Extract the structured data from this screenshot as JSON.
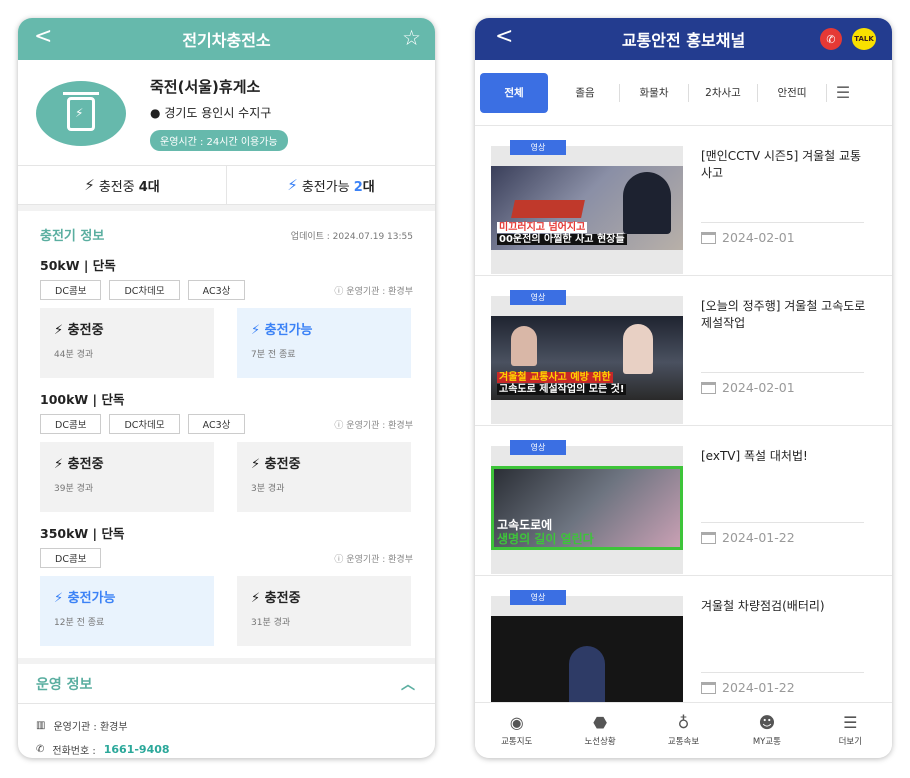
{
  "left": {
    "header": {
      "title": "전기차충전소",
      "back": "<",
      "star": "☆"
    },
    "station": {
      "name": "죽전(서울)휴게소",
      "address": "경기도 용인시 수지구",
      "hours": "운영시간 : 24시간 이용가능"
    },
    "status": {
      "charging_label": "충전중",
      "charging_count": "4대",
      "available_label": "충전가능",
      "available_count": "2",
      "available_unit": "대"
    },
    "charger_info": {
      "title": "충전기 정보",
      "updated": "업데이트 : 2024.07.19 13:55",
      "groups": [
        {
          "power": "50kW | 단독",
          "tags": [
            "DC콤보",
            "DC차데모",
            "AC3상"
          ],
          "operator": "ⓘ 운영기관 : 환경부",
          "slots": [
            {
              "status": "충전중",
              "sub": "44분 경과",
              "available": false
            },
            {
              "status": "충전가능",
              "sub": "7분 전 종료",
              "available": true
            }
          ]
        },
        {
          "power": "100kW | 단독",
          "tags": [
            "DC콤보",
            "DC차데모",
            "AC3상"
          ],
          "operator": "ⓘ 운영기관 : 환경부",
          "slots": [
            {
              "status": "충전중",
              "sub": "39분 경과",
              "available": false
            },
            {
              "status": "충전중",
              "sub": "3분 경과",
              "available": false
            }
          ]
        },
        {
          "power": "350kW | 단독",
          "tags": [
            "DC콤보"
          ],
          "operator": "ⓘ 운영기관 : 환경부",
          "slots": [
            {
              "status": "충전가능",
              "sub": "12분 전 종료",
              "available": true
            },
            {
              "status": "충전중",
              "sub": "31분 경과",
              "available": false
            }
          ]
        }
      ]
    },
    "operation": {
      "title": "운영 정보",
      "operator": "운영기관 : 환경부",
      "phone_label": "전화번호 :",
      "phone": "1661-9408"
    }
  },
  "right": {
    "header": {
      "title": "교통안전 홍보채널",
      "back": "<",
      "talk": "TALK"
    },
    "tabs": [
      "전체",
      "졸음",
      "화물차",
      "2차사고",
      "안전띠"
    ],
    "items": [
      {
        "badge": "영상",
        "title": "[맨인CCTV 시즌5] 겨울철 교통사고",
        "date": "2024-02-01",
        "caption1": "미끄러지고 넘어지고",
        "caption2": "00운전의 아찔한 사고 현장들"
      },
      {
        "badge": "영상",
        "title": "[오늘의 정주행] 겨울철 고속도로 제설작업",
        "date": "2024-02-01",
        "caption1": "겨울철 교통사고 예방 위한",
        "caption2": "고속도로 제설작업의 모든 것!"
      },
      {
        "badge": "영상",
        "title": "[exTV] 폭설 대처법!",
        "date": "2024-01-22",
        "caption1": "고속도로에",
        "caption2": "생명의 길이 열린다"
      },
      {
        "badge": "영상",
        "title": "겨울철 차량점검(배터리)",
        "date": "2024-01-22",
        "caption1": "",
        "caption2": ""
      }
    ],
    "nav": [
      "교통지도",
      "노선상황",
      "교통속보",
      "MY교통",
      "더보기"
    ]
  },
  "colors": {
    "teal": "#66b9ac",
    "navy": "#233c8f",
    "blue": "#3b82f6"
  }
}
